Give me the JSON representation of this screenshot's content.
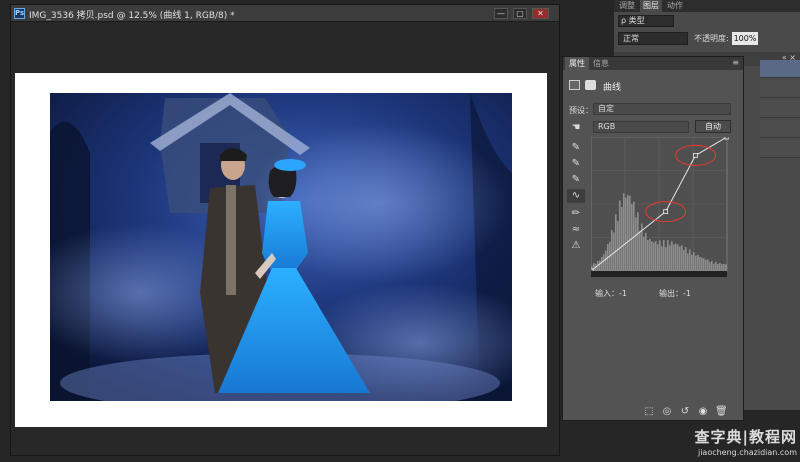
{
  "document": {
    "title": "IMG_3536 拷贝.psd @ 12.5% (曲线 1, RGB/8) *",
    "app_icon_text": "Ps",
    "window_buttons": [
      "—",
      "▢",
      "✕"
    ]
  },
  "right_panel": {
    "tabs": [
      "调整",
      "图层",
      "动作"
    ],
    "active_tab": "图层",
    "kind_filter": "ρ 类型",
    "blend_mode": "正常",
    "opacity_label": "不透明度:",
    "opacity_value": "100%",
    "panel_arrows": "« ×"
  },
  "properties": {
    "tabs": [
      "属性",
      "信息"
    ],
    "active_tab": "属性",
    "panel_title": "曲线",
    "preset_label": "预设：",
    "preset_value": "自定",
    "channel_value": "RGB",
    "auto_button": "自动",
    "input_label": "输入：-1",
    "output_label": "输出：-1",
    "tools": [
      "hand-target-icon",
      "eyedropper-black-icon",
      "eyedropper-gray-icon",
      "eyedropper-white-icon",
      "curve-edit-icon",
      "pencil-icon",
      "smooth-icon",
      "clipping-warning-icon"
    ],
    "bottom_icons": [
      "clip-to-layer-icon",
      "view-previous-icon",
      "reset-icon",
      "visibility-icon",
      "delete-icon"
    ]
  },
  "curve": {
    "points": [
      [
        0,
        0
      ],
      [
        140,
        113
      ],
      [
        196,
        220
      ],
      [
        255,
        255
      ]
    ],
    "highlighted_points": [
      [
        140,
        113
      ],
      [
        196,
        220
      ]
    ],
    "highlight_color": "#e8382b"
  },
  "watermark": {
    "line1": "查字典|教程网",
    "line2": "jiaocheng.chazidian.com"
  },
  "colors": {
    "accent_blue": "#3a6fd0",
    "photo_dark": "#0f1e4a",
    "dress_blue": "#1e9ae8"
  }
}
